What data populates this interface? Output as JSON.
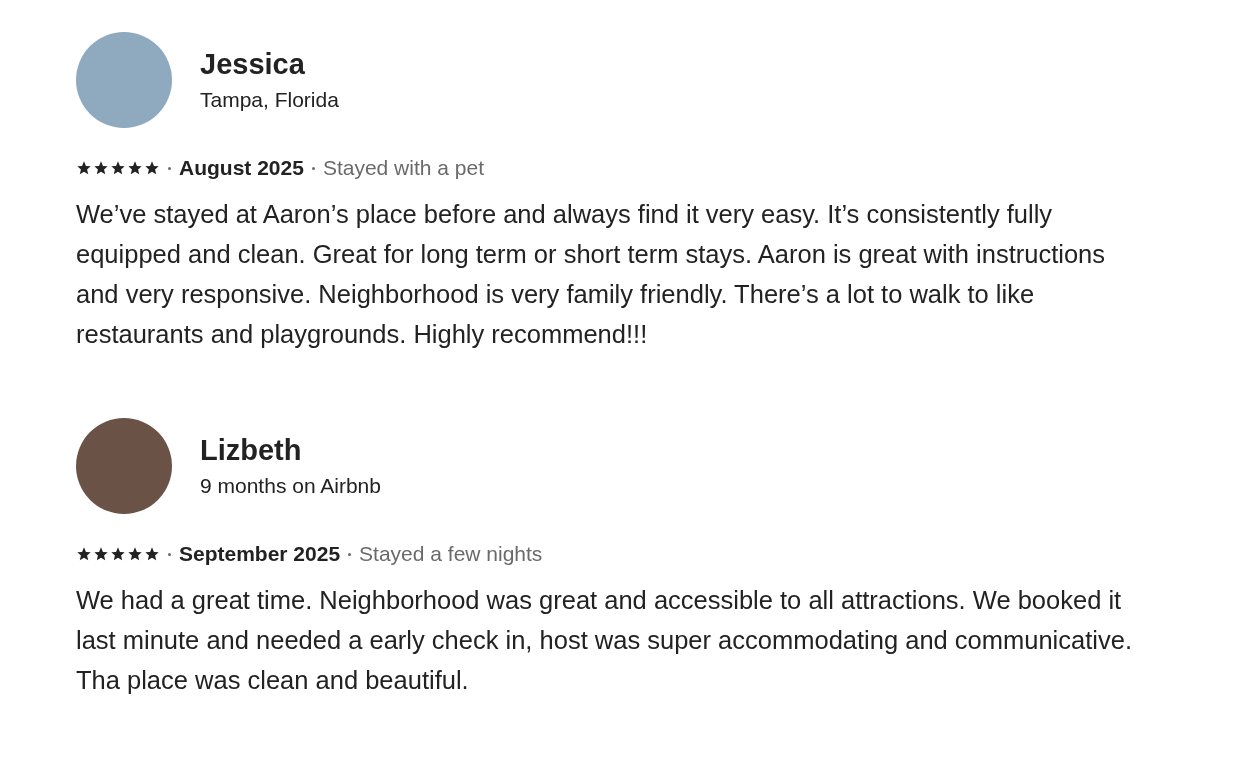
{
  "reviews": [
    {
      "name": "Jessica",
      "subtitle": "Tampa, Florida",
      "stars": 5,
      "date": "August 2025",
      "stay": "Stayed with a pet",
      "text": "We’ve stayed at Aaron’s place before and always find it very easy. It’s consistently fully equipped and clean. Great for long term or short term stays. Aaron is great with instructions and very responsive. Neighborhood is very family friendly. There’s a lot to walk to like restaurants and playgrounds. Highly recommend!!!"
    },
    {
      "name": "Lizbeth",
      "subtitle": "9 months on Airbnb",
      "stars": 5,
      "date": "September 2025",
      "stay": "Stayed a few nights",
      "text": "We had a great time. Neighborhood was great and accessible to all attractions. We booked it last minute and needed a early check in, host was super accommodating and communicative. Tha place was clean and beautiful."
    }
  ]
}
